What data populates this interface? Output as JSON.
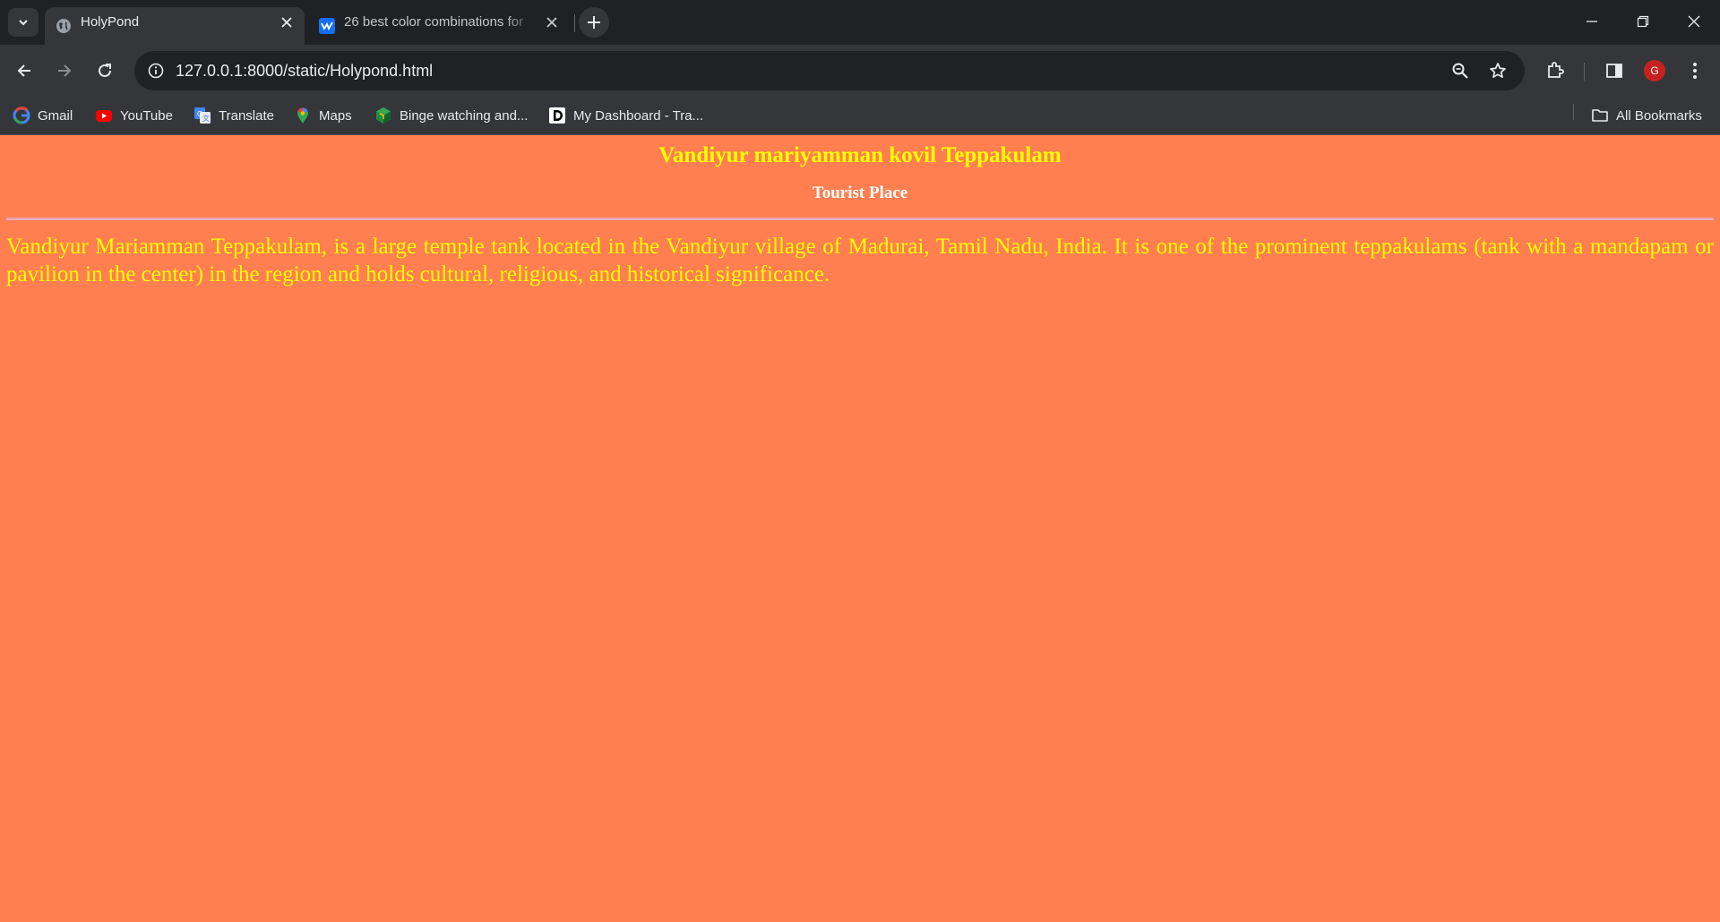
{
  "browser": {
    "tabs": [
      {
        "title": "HolyPond",
        "active": true,
        "favicon": "globe-icon"
      },
      {
        "title": "26 best color combinations for",
        "active": false,
        "favicon": "webflow-icon"
      }
    ],
    "url": "127.0.0.1:8000/static/Holypond.html",
    "profile_initial": "G",
    "bookmarks": [
      {
        "label": "Gmail",
        "icon": "google-icon"
      },
      {
        "label": "YouTube",
        "icon": "youtube-icon"
      },
      {
        "label": "Translate",
        "icon": "translate-icon"
      },
      {
        "label": "Maps",
        "icon": "maps-icon"
      },
      {
        "label": "Binge watching and...",
        "icon": "binge-icon"
      },
      {
        "label": "My Dashboard - Tra...",
        "icon": "dashboard-icon"
      }
    ],
    "all_bookmarks_label": "All Bookmarks"
  },
  "page": {
    "heading": "Vandiyur mariyamman kovil Teppakulam",
    "subheading": "Tourist Place",
    "paragraph": "Vandiyur Mariamman Teppakulam, is a large temple tank located in the Vandiyur village of Madurai, Tamil Nadu, India. It is one of the prominent teppakulams (tank with a mandapam or pavilion in the center) in the region and holds cultural, religious, and historical significance.",
    "background_color": "#ff7f50",
    "text_color": "#ffff00"
  }
}
